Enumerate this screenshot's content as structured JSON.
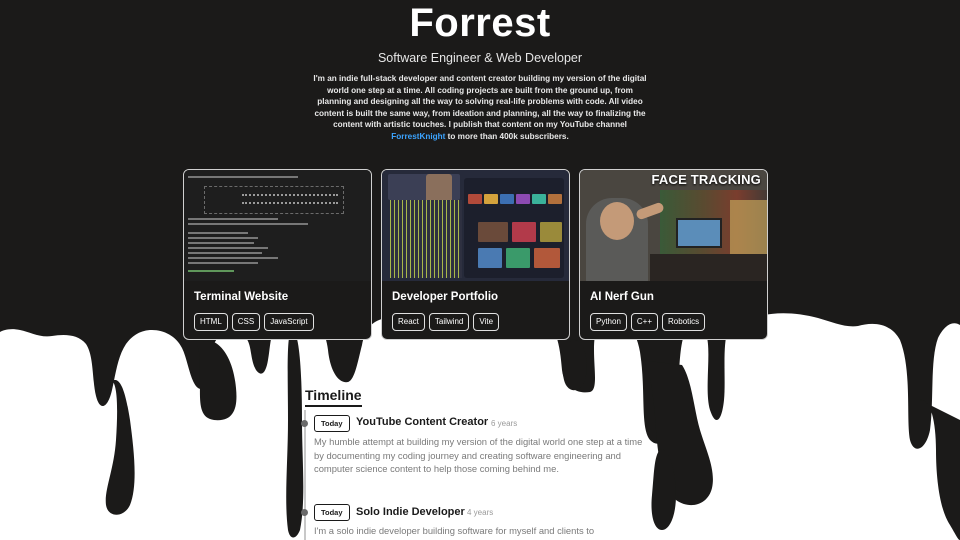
{
  "hero": {
    "name": "Forrest",
    "tagline": "Software Engineer & Web Developer",
    "bio_text": "I'm an indie full-stack developer and content creator building my version of the digital world one step at a time. All coding projects are built from the ground up, from planning and designing all the way to solving real-life problems with code. All video content is built the same way, from ideation and planning, all the way to finalizing the content with artistic touches. I publish that content on my YouTube channel ",
    "bio_link": "ForrestKnight",
    "bio_end": " to more than 400k subscribers."
  },
  "projects": [
    {
      "title": "Terminal Website",
      "tags": [
        "HTML",
        "CSS",
        "JavaScript"
      ]
    },
    {
      "title": "Developer Portfolio",
      "tags": [
        "React",
        "Tailwind",
        "Vite"
      ]
    },
    {
      "title": "AI Nerf Gun",
      "thumb_caption": "FACE TRACKING",
      "tags": [
        "Python",
        "C++",
        "Robotics"
      ]
    }
  ],
  "timeline": {
    "heading": "Timeline",
    "items": [
      {
        "badge": "Today",
        "role": "YouTube Content Creator",
        "duration": "6 years",
        "description": "My humble attempt at building my version of the digital world one step at a time by documenting my coding journey and creating software engineering and computer science content to help those coming behind me."
      },
      {
        "badge": "Today",
        "role": "Solo Indie Developer",
        "duration": "4 years",
        "description": "I'm a solo indie developer building software for myself and clients to"
      }
    ]
  },
  "colors": {
    "background_dark": "#1b1a19",
    "background_light": "#ffffff",
    "link": "#3ca4ff"
  }
}
